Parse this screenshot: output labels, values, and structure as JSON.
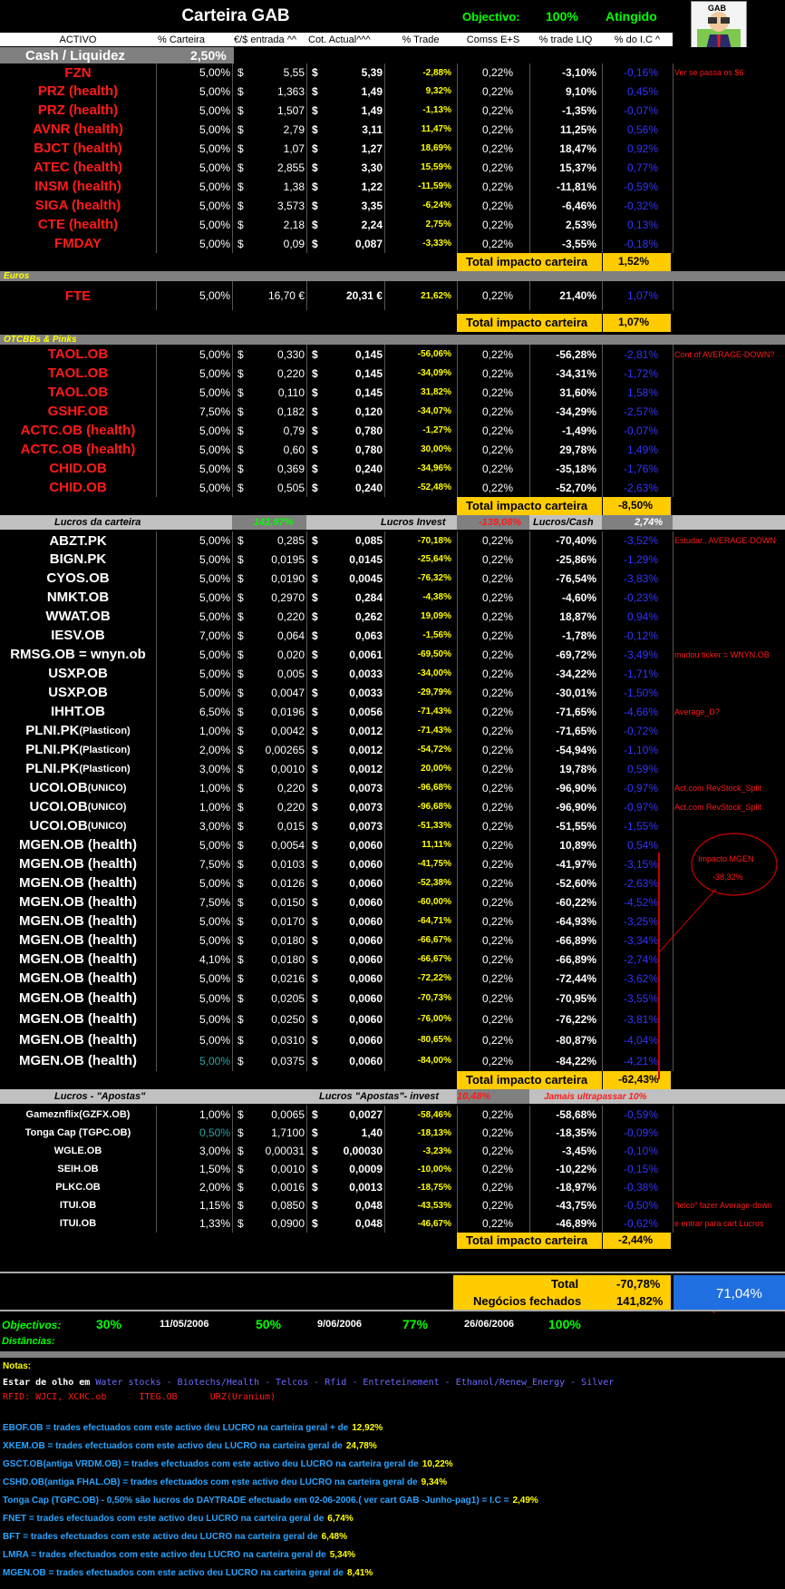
{
  "title": "Carteira GAB",
  "objectivo": {
    "label": "Objectivo:",
    "pct": "100%",
    "status": "Atingido"
  },
  "logo_text": "GAB",
  "headers": [
    "ACTIVO",
    "% Carteira",
    "€/$ entrada ^^",
    "Cot. Actual^^^",
    "% Trade",
    "Comss E+S",
    "% trade LIQ",
    "% do I.C ^"
  ],
  "cash": {
    "label": "Cash / Liquidez",
    "pct": "2,50%"
  },
  "us": [
    {
      "n": "FZN",
      "p": "5,00%",
      "e": "5,55",
      "a": "5,39",
      "t": "-2,88%",
      "c": "0,22%",
      "l": "-3,10%",
      "ic": "-0,16%",
      "note": "Ver se passa os $6"
    },
    {
      "n": "PRZ  (health)",
      "p": "5,00%",
      "e": "1,363",
      "a": "1,49",
      "t": "9,32%",
      "c": "0,22%",
      "l": "9,10%",
      "ic": "0,45%",
      "note": ""
    },
    {
      "n": "PRZ  (health)",
      "p": "5,00%",
      "e": "1,507",
      "a": "1,49",
      "t": "-1,13%",
      "c": "0,22%",
      "l": "-1,35%",
      "ic": "-0,07%",
      "note": ""
    },
    {
      "n": "AVNR (health)",
      "p": "5,00%",
      "e": "2,79",
      "a": "3,11",
      "t": "11,47%",
      "c": "0,22%",
      "l": "11,25%",
      "ic": "0,56%",
      "note": ""
    },
    {
      "n": "BJCT (health)",
      "p": "5,00%",
      "e": "1,07",
      "a": "1,27",
      "t": "18,69%",
      "c": "0,22%",
      "l": "18,47%",
      "ic": "0,92%",
      "note": ""
    },
    {
      "n": "ATEC  (health)",
      "p": "5,00%",
      "e": "2,855",
      "a": "3,30",
      "t": "15,59%",
      "c": "0,22%",
      "l": "15,37%",
      "ic": "0,77%",
      "note": ""
    },
    {
      "n": "INSM  (health)",
      "p": "5,00%",
      "e": "1,38",
      "a": "1,22",
      "t": "-11,59%",
      "c": "0,22%",
      "l": "-11,81%",
      "ic": "-0,59%",
      "note": ""
    },
    {
      "n": "SIGA  (health)",
      "p": "5,00%",
      "e": "3,573",
      "a": "3,35",
      "t": "-6,24%",
      "c": "0,22%",
      "l": "-6,46%",
      "ic": "-0,32%",
      "note": ""
    },
    {
      "n": "CTE  (health)",
      "p": "5,00%",
      "e": "2,18",
      "a": "2,24",
      "t": "2,75%",
      "c": "0,22%",
      "l": "2,53%",
      "ic": "0,13%",
      "note": ""
    },
    {
      "n": "FMDAY",
      "p": "5,00%",
      "e": "0,09",
      "a": "0,087",
      "t": "-3,33%",
      "c": "0,22%",
      "l": "-3,55%",
      "ic": "-0,18%",
      "note": ""
    }
  ],
  "us_total": {
    "label": "Total impacto carteira",
    "value": "1,52%"
  },
  "euros_label": "Euros",
  "fte": {
    "n": "FTE",
    "p": "5,00%",
    "e": "16,70 €",
    "a": "20,31 €",
    "t": "21,62%",
    "c": "0,22%",
    "l": "21,40%",
    "ic": "1,07%"
  },
  "euros_total": {
    "label": "Total impacto carteira",
    "value": "1,07%"
  },
  "otc_label": "OTCBBs & Pinks",
  "otc": [
    {
      "n": "TAOL.OB",
      "p": "5,00%",
      "e": "0,330",
      "a": "0,145",
      "t": "-56,06%",
      "c": "0,22%",
      "l": "-56,28%",
      "ic": "-2,81%",
      "note": "Cont of  AVERAGE-DOWN?"
    },
    {
      "n": "TAOL.OB",
      "p": "5,00%",
      "e": "0,220",
      "a": "0,145",
      "t": "-34,09%",
      "c": "0,22%",
      "l": "-34,31%",
      "ic": "-1,72%",
      "note": ""
    },
    {
      "n": "TAOL.OB",
      "p": "5,00%",
      "e": "0,110",
      "a": "0,145",
      "t": "31,82%",
      "c": "0,22%",
      "l": "31,60%",
      "ic": "1,58%",
      "note": ""
    },
    {
      "n": "GSHF.OB",
      "p": "7,50%",
      "e": "0,182",
      "a": "0,120",
      "t": "-34,07%",
      "c": "0,22%",
      "l": "-34,29%",
      "ic": "-2,57%",
      "note": ""
    },
    {
      "n": "ACTC.OB  (health)",
      "p": "5,00%",
      "e": "0,79",
      "a": "0,780",
      "t": "-1,27%",
      "c": "0,22%",
      "l": "-1,49%",
      "ic": "-0,07%",
      "note": ""
    },
    {
      "n": "ACTC.OB  (health)",
      "p": "5,00%",
      "e": "0,60",
      "a": "0,780",
      "t": "30,00%",
      "c": "0,22%",
      "l": "29,78%",
      "ic": "1,49%",
      "note": ""
    },
    {
      "n": "CHID.OB",
      "p": "5,00%",
      "e": "0,369",
      "a": "0,240",
      "t": "-34,96%",
      "c": "0,22%",
      "l": "-35,18%",
      "ic": "-1,76%",
      "note": ""
    },
    {
      "n": "CHID.OB",
      "p": "5,00%",
      "e": "0,505",
      "a": "0,240",
      "t": "-52,48%",
      "c": "0,22%",
      "l": "-52,70%",
      "ic": "-2,63%",
      "note": ""
    }
  ],
  "otc_total": {
    "label": "Total impacto carteira",
    "value": "-8,50%"
  },
  "lucros_bar": {
    "l1": "Lucros da carteira",
    "v1": "141,97%",
    "l2": "Lucros Invest",
    "v2": "-139,08%",
    "l3": "Lucros/Cash",
    "v3": "2,74%"
  },
  "pinks": [
    {
      "n": "ABZT.PK",
      "sub": "",
      "p": "5,00%",
      "e": "0,285",
      "a": "0,085",
      "t": "-70,18%",
      "c": "0,22%",
      "l": "-70,40%",
      "ic": "-3,52%",
      "note": "Estudar.. AVERAGE-DOWN"
    },
    {
      "n": "BIGN.PK",
      "sub": "",
      "p": "5,00%",
      "e": "0,0195",
      "a": "0,0145",
      "t": "-25,64%",
      "c": "0,22%",
      "l": "-25,86%",
      "ic": "-1,29%",
      "note": ""
    },
    {
      "n": "CYOS.OB",
      "sub": "",
      "p": "5,00%",
      "e": "0,0190",
      "a": "0,0045",
      "t": "-76,32%",
      "c": "0,22%",
      "l": "-76,54%",
      "ic": "-3,83%",
      "note": ""
    },
    {
      "n": "NMKT.OB",
      "sub": "",
      "p": "5,00%",
      "e": "0,2970",
      "a": "0,284",
      "t": "-4,38%",
      "c": "0,22%",
      "l": "-4,60%",
      "ic": "-0,23%",
      "note": ""
    },
    {
      "n": "WWAT.OB",
      "sub": "",
      "p": "5,00%",
      "e": "0,220",
      "a": "0,262",
      "t": "19,09%",
      "c": "0,22%",
      "l": "18,87%",
      "ic": "0,94%",
      "note": ""
    },
    {
      "n": "IESV.OB",
      "sub": "",
      "p": "7,00%",
      "e": "0,064",
      "a": "0,063",
      "t": "-1,56%",
      "c": "0,22%",
      "l": "-1,78%",
      "ic": "-0,12%",
      "note": ""
    },
    {
      "n": "RMSG.OB = wnyn.ob",
      "sub": "",
      "p": "5,00%",
      "e": "0,020",
      "a": "0,0061",
      "t": "-69,50%",
      "c": "0,22%",
      "l": "-69,72%",
      "ic": "-3,49%",
      "note": "mudou ticker = WNYN.OB"
    },
    {
      "n": "USXP.OB",
      "sub": "",
      "p": "5,00%",
      "e": "0,005",
      "a": "0,0033",
      "t": "-34,00%",
      "c": "0,22%",
      "l": "-34,22%",
      "ic": "-1,71%",
      "note": ""
    },
    {
      "n": "USXP.OB",
      "sub": "",
      "p": "5,00%",
      "e": "0,0047",
      "a": "0,0033",
      "t": "-29,79%",
      "c": "0,22%",
      "l": "-30,01%",
      "ic": "-1,50%",
      "note": ""
    },
    {
      "n": "IHHT.OB",
      "sub": "",
      "p": "6,50%",
      "e": "0,0196",
      "a": "0,0056",
      "t": "-71,43%",
      "c": "0,22%",
      "l": "-71,65%",
      "ic": "-4,66%",
      "note": "Average_D?"
    },
    {
      "n": "PLNI.PK",
      "sub": "(Plasticon)",
      "p": "1,00%",
      "e": "0,0042",
      "a": "0,0012",
      "t": "-71,43%",
      "c": "0,22%",
      "l": "-71,65%",
      "ic": "-0,72%",
      "note": ""
    },
    {
      "n": "PLNI.PK",
      "sub": "(Plasticon)",
      "p": "2,00%",
      "e": "0,00265",
      "a": "0,0012",
      "t": "-54,72%",
      "c": "0,22%",
      "l": "-54,94%",
      "ic": "-1,10%",
      "note": ""
    },
    {
      "n": "PLNI.PK",
      "sub": "(Plasticon)",
      "p": "3,00%",
      "e": "0,0010",
      "a": "0,0012",
      "t": "20,00%",
      "c": "0,22%",
      "l": "19,78%",
      "ic": "0,59%",
      "note": ""
    },
    {
      "n": "UCOI.OB",
      "sub": "(UNICO)",
      "p": "1,00%",
      "e": "0,220",
      "a": "0,0073",
      "t": "-96,68%",
      "c": "0,22%",
      "l": "-96,90%",
      "ic": "-0,97%",
      "note": "Act.com RevStock_Split"
    },
    {
      "n": "UCOI.OB",
      "sub": "(UNICO)",
      "p": "1,00%",
      "e": "0,220",
      "a": "0,0073",
      "t": "-96,68%",
      "c": "0,22%",
      "l": "-96,90%",
      "ic": "-0,97%",
      "note": "Act.com RevStock_Split"
    },
    {
      "n": "UCOI.OB",
      "sub": "(UNICO)",
      "p": "3,00%",
      "e": "0,015",
      "a": "0,0073",
      "t": "-51,33%",
      "c": "0,22%",
      "l": "-51,55%",
      "ic": "-1,55%",
      "note": ""
    },
    {
      "n": "MGEN.OB  (health)",
      "sub": "",
      "p": "5,00%",
      "e": "0,0054",
      "a": "0,0060",
      "t": "11,11%",
      "c": "0,22%",
      "l": "10,89%",
      "ic": "0,54%",
      "note": ""
    },
    {
      "n": "MGEN.OB  (health)",
      "sub": "",
      "p": "7,50%",
      "e": "0,0103",
      "a": "0,0060",
      "t": "-41,75%",
      "c": "0,22%",
      "l": "-41,97%",
      "ic": "-3,15%",
      "note": ""
    },
    {
      "n": "MGEN.OB  (health)",
      "sub": "",
      "p": "5,00%",
      "e": "0,0126",
      "a": "0,0060",
      "t": "-52,38%",
      "c": "0,22%",
      "l": "-52,60%",
      "ic": "-2,63%",
      "note": ""
    },
    {
      "n": "MGEN.OB  (health)",
      "sub": "",
      "p": "7,50%",
      "e": "0,0150",
      "a": "0,0060",
      "t": "-60,00%",
      "c": "0,22%",
      "l": "-60,22%",
      "ic": "-4,52%",
      "note": ""
    },
    {
      "n": "MGEN.OB  (health)",
      "sub": "",
      "p": "5,00%",
      "e": "0,0170",
      "a": "0,0060",
      "t": "-64,71%",
      "c": "0,22%",
      "l": "-64,93%",
      "ic": "-3,25%",
      "note": ""
    },
    {
      "n": "MGEN.OB  (health)",
      "sub": "",
      "p": "5,00%",
      "e": "0,0180",
      "a": "0,0060",
      "t": "-66,67%",
      "c": "0,22%",
      "l": "-66,89%",
      "ic": "-3,34%",
      "note": ""
    },
    {
      "n": "MGEN.OB  (health)",
      "sub": "",
      "p": "4,10%",
      "e": "0,0180",
      "a": "0,0060",
      "t": "-66,67%",
      "c": "0,22%",
      "l": "-66,89%",
      "ic": "-2,74%",
      "note": ""
    },
    {
      "n": "MGEN.OB  (health)",
      "sub": "",
      "p": "5,00%",
      "e": "0,0216",
      "a": "0,0060",
      "t": "-72,22%",
      "c": "0,22%",
      "l": "-72,44%",
      "ic": "-3,62%",
      "note": ""
    },
    {
      "n": "MGEN.OB  (health)",
      "sub": "",
      "p": "5,00%",
      "e": "0,0205",
      "a": "0,0060",
      "t": "-70,73%",
      "c": "0,22%",
      "l": "-70,95%",
      "ic": "-3,55%",
      "note": ""
    },
    {
      "n": "MGEN.OB  (health)",
      "sub": "",
      "p": "5,00%",
      "e": "0,0250",
      "a": "0,0060",
      "t": "-76,00%",
      "c": "0,22%",
      "l": "-76,22%",
      "ic": "-3,81%",
      "note": ""
    },
    {
      "n": "MGEN.OB  (health)",
      "sub": "",
      "p": "5,00%",
      "e": "0,0310",
      "a": "0,0060",
      "t": "-80,65%",
      "c": "0,22%",
      "l": "-80,87%",
      "ic": "-4,04%",
      "note": ""
    },
    {
      "n": "MGEN.OB  (health)",
      "sub": "",
      "p": "5,00%",
      "e": "0,0375",
      "a": "0,0060",
      "t": "-84,00%",
      "c": "0,22%",
      "l": "-84,22%",
      "ic": "-4,21%",
      "note": ""
    }
  ],
  "mgen_note": {
    "line1": "Impacto MGEN",
    "line2": "-38,32%"
  },
  "pinks_total": {
    "label": "Total impacto carteira",
    "value": "-62,43%"
  },
  "apostas_bar": {
    "l1": "Lucros - \"Apostas\"",
    "l2": "Lucros \"Apostas\"- invest",
    "v2": "10,48%",
    "l3": "Jamais ultrapassar 10%"
  },
  "apostas": [
    {
      "n": "Gameznflix(GZFX.OB)",
      "p": "1,00%",
      "e": "0,0065",
      "a": "0,0027",
      "t": "-58,46%",
      "c": "0,22%",
      "l": "-58,68%",
      "ic": "-0,59%",
      "note": ""
    },
    {
      "n": "Tonga Cap (TGPC.OB)",
      "p": "0,50%",
      "e": "1,7100",
      "a": "1,40",
      "t": "-18,13%",
      "c": "0,22%",
      "l": "-18,35%",
      "ic": "-0,09%",
      "note": ""
    },
    {
      "n": "WGLE.OB",
      "p": "3,00%",
      "e": "0,00031",
      "a": "0,00030",
      "t": "-3,23%",
      "c": "0,22%",
      "l": "-3,45%",
      "ic": "-0,10%",
      "note": ""
    },
    {
      "n": "SEIH.OB",
      "p": "1,50%",
      "e": "0,0010",
      "a": "0,0009",
      "t": "-10,00%",
      "c": "0,22%",
      "l": "-10,22%",
      "ic": "-0,15%",
      "note": ""
    },
    {
      "n": "PLKC.OB",
      "p": "2,00%",
      "e": "0,0016",
      "a": "0,0013",
      "t": "-18,75%",
      "c": "0,22%",
      "l": "-18,97%",
      "ic": "-0,38%",
      "note": ""
    },
    {
      "n": "ITUI.OB",
      "p": "1,15%",
      "e": "0,0850",
      "a": "0,048",
      "t": "-43,53%",
      "c": "0,22%",
      "l": "-43,75%",
      "ic": "-0,50%",
      "note": "\"telco\" fazer Average-down"
    },
    {
      "n": "ITUI.OB",
      "p": "1,33%",
      "e": "0,0900",
      "a": "0,048",
      "t": "-46,67%",
      "c": "0,22%",
      "l": "-46,89%",
      "ic": "-0,62%",
      "note": "e entrar para cart Lucros"
    }
  ],
  "apostas_total": {
    "label": "Total impacto carteira",
    "value": "-2,44%"
  },
  "grand_total": {
    "label": "Total",
    "value": "-70,78%"
  },
  "fechados": {
    "label": "Negócios fechados",
    "value": "141,82%"
  },
  "result": "71,04%",
  "objectivos": {
    "label": "Objectivos:",
    "p1": "30%",
    "d1": "11/05/2006",
    "p2": "50%",
    "d2": "9/06/2006",
    "p3": "77%",
    "d3": "26/06/2006",
    "p4": "100%",
    "dist": "Distâncias:"
  },
  "notas": {
    "title": "Notas:",
    "olho_label": "Estar de olho em",
    "olho_items": "Water stocks - Biotechs/Health - Telcos - Rfid - Entreteinement - Ethanol/Renew_Energy - Silver",
    "rfid": "RFID: WJCI, XCHC.ob      ITEG.OB      URZ(Uranium)",
    "lines": [
      {
        "text": "EBOF.OB = trades efectuados com este activo  deu LUCRO na carteira geral + de",
        "value": "12,92%"
      },
      {
        "text": "XKEM.OB = trades efectuados com este activo  deu LUCRO na carteira geral de",
        "value": "24,78%"
      },
      {
        "text": "GSCT.OB(antiga VRDM.OB) = trades efectuados com este activo  deu LUCRO na carteira geral de",
        "value": "10,22%"
      },
      {
        "text": "CSHD.OB(antiga FHAL.OB) = trades efectuados com este activo  deu LUCRO na carteira geral de",
        "value": "9,34%"
      },
      {
        "text": "Tonga Cap (TGPC.OB) -  0,50% são lucros  do DAYTRADE efectuado em 02-06-2006.( ver cart GAB -Junho-pag1) = I.C =",
        "value": "2,49%"
      },
      {
        "text": "FNET = trades efectuados com este activo  deu LUCRO na carteira geral de",
        "value": "6,74%"
      },
      {
        "text": "BFT = trades efectuados com este activo  deu LUCRO na carteira geral de",
        "value": "6,48%"
      },
      {
        "text": "LMRA = trades efectuados com este activo  deu LUCRO na carteira geral de",
        "value": "5,34%"
      },
      {
        "text": "MGEN.OB = trades efectuados com este activo  deu LUCRO na carteira geral de",
        "value": "8,41%"
      }
    ]
  }
}
